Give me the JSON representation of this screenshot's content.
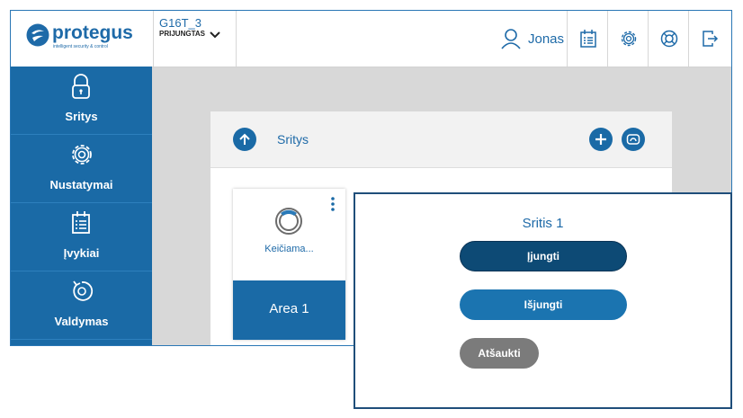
{
  "brand": {
    "name": "protegus",
    "tagline": "intelligent security & control"
  },
  "device": {
    "name": "G16T_3",
    "status": "PRIJUNGTAS"
  },
  "user": {
    "name": "Jonas"
  },
  "header_icons": [
    "user-icon",
    "calendar-list-icon",
    "gear-icon",
    "lifebuoy-icon",
    "logout-icon"
  ],
  "sidebar": {
    "items": [
      {
        "label": "Sritys",
        "icon": "padlock-icon"
      },
      {
        "label": "Nustatymai",
        "icon": "gear-icon"
      },
      {
        "label": "Įvykiai",
        "icon": "calendar-list-icon"
      },
      {
        "label": "Valdymas",
        "icon": "rotate-icon"
      }
    ]
  },
  "panel": {
    "title": "Sritys"
  },
  "area_card": {
    "status": "Keičiama...",
    "name": "Area 1"
  },
  "dialog": {
    "title": "Sritis 1",
    "arm_label": "Įjungti",
    "disarm_label": "Išjungti",
    "cancel_label": "Atšaukti"
  },
  "colors": {
    "brand": "#1a6aa6",
    "dark_brand": "#0d4a75",
    "cancel": "#7b7b7b"
  }
}
